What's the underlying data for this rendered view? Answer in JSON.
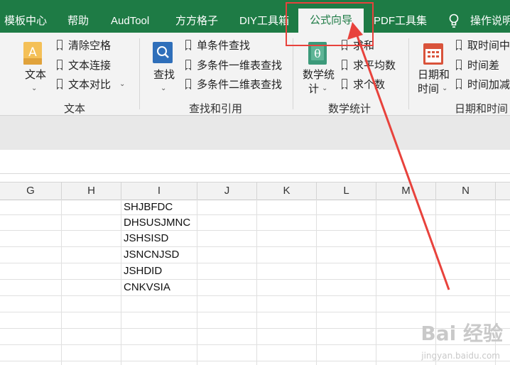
{
  "tabs": [
    {
      "label": "模板中心"
    },
    {
      "label": "帮助"
    },
    {
      "label": "AudTool"
    },
    {
      "label": "方方格子"
    },
    {
      "label": "DIY工具箱"
    },
    {
      "label": "公式向导"
    },
    {
      "label": "PDF工具集"
    }
  ],
  "tell_me": "操作说明",
  "ribbon": {
    "text_group": {
      "big_label": "文本",
      "items": [
        "清除空格",
        "文本连接",
        "文本对比"
      ],
      "group_label": "文本"
    },
    "lookup_group": {
      "big_label": "查找",
      "items": [
        "单条件查找",
        "多条件一维表查找",
        "多条件二维表查找"
      ],
      "group_label": "查找和引用"
    },
    "math_group": {
      "big_label_line1": "数学统",
      "big_label_line2": "计",
      "items": [
        "求和",
        "求平均数",
        "求个数"
      ],
      "group_label": "数学统计"
    },
    "date_group": {
      "big_label_line1": "日期和",
      "big_label_line2": "时间",
      "items": [
        "取时间中",
        "时间差",
        "时间加减"
      ],
      "group_label": "日期和时间"
    }
  },
  "columns": [
    "G",
    "H",
    "I",
    "J",
    "K",
    "L",
    "M",
    "N"
  ],
  "cells_column_I": [
    "SHJBFDC",
    "DHSUSJMNC",
    "JSHSISD",
    "JSNCNJSD",
    "JSHDID",
    "CNKVSIA"
  ],
  "watermark": {
    "main": "Bai 经验",
    "sub": "jingyan.baidu.com"
  },
  "colors": {
    "tab_green": "#1e7b45",
    "highlight_red": "#e8423c"
  }
}
